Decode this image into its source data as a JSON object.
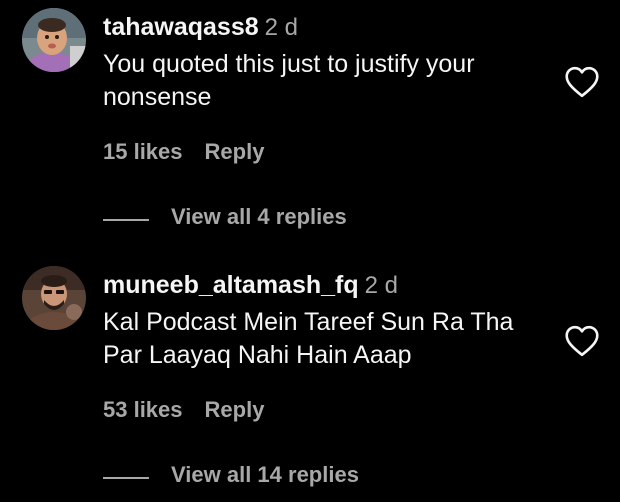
{
  "comments": [
    {
      "username": "tahawaqass8",
      "time": "2 d",
      "text": "You quoted this just to justify your nonsense",
      "likes": "15 likes",
      "reply_label": "Reply",
      "view_replies": "View all 4 replies"
    },
    {
      "username": "muneeb_altamash_fq",
      "time": "2 d",
      "text": "Kal Podcast Mein Tareef Sun Ra Tha Par Laayaq Nahi Hain Aaap",
      "likes": "53 likes",
      "reply_label": "Reply",
      "view_replies": "View all 14 replies"
    }
  ],
  "colors": {
    "background": "#000000",
    "primary_text": "#f5f5f5",
    "secondary_text": "#a8a8a8"
  },
  "icons": {
    "like": "heart-outline-icon"
  }
}
